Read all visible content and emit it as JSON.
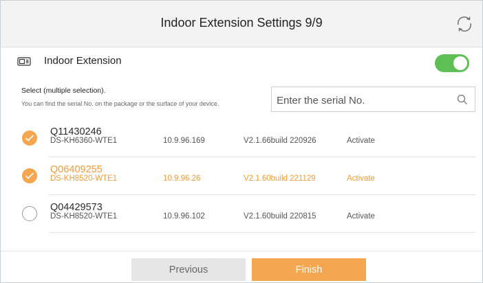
{
  "header": {
    "title": "Indoor Extension Settings 9/9",
    "refresh_icon": "refresh-icon"
  },
  "extension": {
    "label": "Indoor Extension",
    "enabled": true,
    "icon": "device-icon"
  },
  "hint": {
    "line1": "Select (multiple selection).",
    "line2": "You can find the serial No. on the package or the surface of your device."
  },
  "search": {
    "placeholder": "Enter the serial No.",
    "value": ""
  },
  "devices": [
    {
      "serial": "Q11430246",
      "model": "DS-KH6360-WTE1",
      "ip": "10.9.96.169",
      "version": "V2.1.66build 220926",
      "status": "Activate",
      "selected": true,
      "highlighted": false
    },
    {
      "serial": "Q06409255",
      "model": "DS-KH8520-WTE1",
      "ip": "10.9.96.26",
      "version": "V2.1.60build 221129",
      "status": "Activate",
      "selected": true,
      "highlighted": true
    },
    {
      "serial": "Q04429573",
      "model": "DS-KH8520-WTE1",
      "ip": "10.9.96.102",
      "version": "V2.1.60build 220815",
      "status": "Activate",
      "selected": false,
      "highlighted": false
    }
  ],
  "buttons": {
    "previous": "Previous",
    "finish": "Finish"
  },
  "colors": {
    "accent": "#f4a650",
    "highlight_text": "#f09c3a",
    "toggle_on": "#5ebf54"
  }
}
